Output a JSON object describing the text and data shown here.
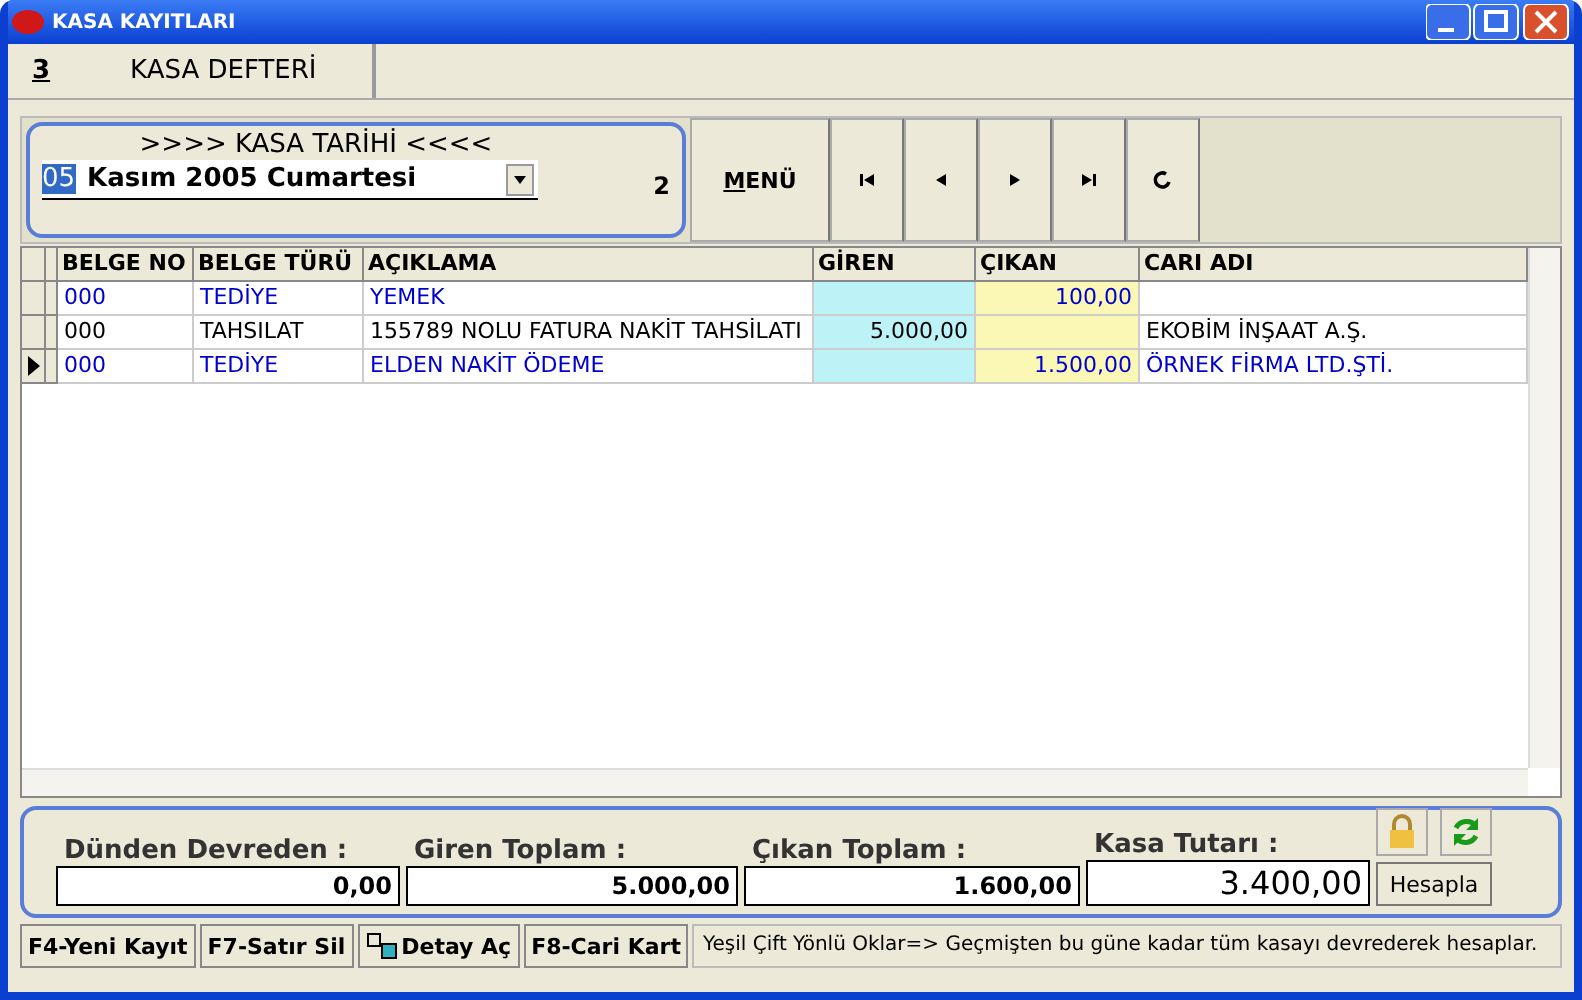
{
  "window": {
    "title": "KASA KAYITLARI"
  },
  "tabs": [
    {
      "number": "3",
      "label": "KASA DEFTERİ",
      "selected": true
    }
  ],
  "date_box": {
    "title": ">>>> KASA TARİHİ <<<<",
    "day": "05",
    "date_rest": "Kasım  2005 Cumartesi",
    "count": "2"
  },
  "toolbar": {
    "menu": "MENÜ",
    "nav": [
      {
        "kind": "first"
      },
      {
        "kind": "prev"
      },
      {
        "kind": "next"
      },
      {
        "kind": "last"
      },
      {
        "kind": "refresh"
      }
    ]
  },
  "table": {
    "columns": [
      "BELGE NO",
      "BELGE TÜRÜ",
      "AÇIKLAMA",
      "GİREN",
      "ÇIKAN",
      "CARI ADI"
    ],
    "rows": [
      {
        "selected": false,
        "color": "#0000cc",
        "cells": [
          "000",
          "TEDİYE",
          "YEMEK",
          "",
          "100,00",
          ""
        ]
      },
      {
        "selected": false,
        "color": "#000000",
        "cells": [
          "000",
          "TAHSILAT",
          "155789 NOLU FATURA NAKİT TAHSİLATI",
          "5.000,00",
          "",
          "EKOBİM İNŞAAT A.Ş."
        ]
      },
      {
        "selected": true,
        "color": "#0000cc",
        "cells": [
          "000",
          "TEDİYE",
          "ELDEN NAKİT ÖDEME",
          "",
          "1.500,00",
          "ÖRNEK FİRMA LTD.ŞTİ."
        ]
      }
    ]
  },
  "totals": [
    {
      "label": "Dünden Devreden :",
      "value": "0,00"
    },
    {
      "label": "Giren Toplam :",
      "value": "5.000,00"
    },
    {
      "label": "Çıkan Toplam :",
      "value": "1.600,00"
    },
    {
      "label": "Kasa Tutarı :",
      "value": "3.400,00"
    }
  ],
  "calc_button": "Hesapla",
  "bottom_buttons": [
    {
      "label": "F4-Yeni Kayıt",
      "kind": "plain"
    },
    {
      "label": "F7-Satır Sil",
      "kind": "plain"
    },
    {
      "label": "Detay Aç",
      "kind": "icon"
    },
    {
      "label": "F8-Cari Kart",
      "kind": "plain"
    }
  ],
  "hint": "Yeşil Çift Yönlü Oklar=> Geçmişten bu güne kadar tüm kasayı devrederek hesaplar."
}
